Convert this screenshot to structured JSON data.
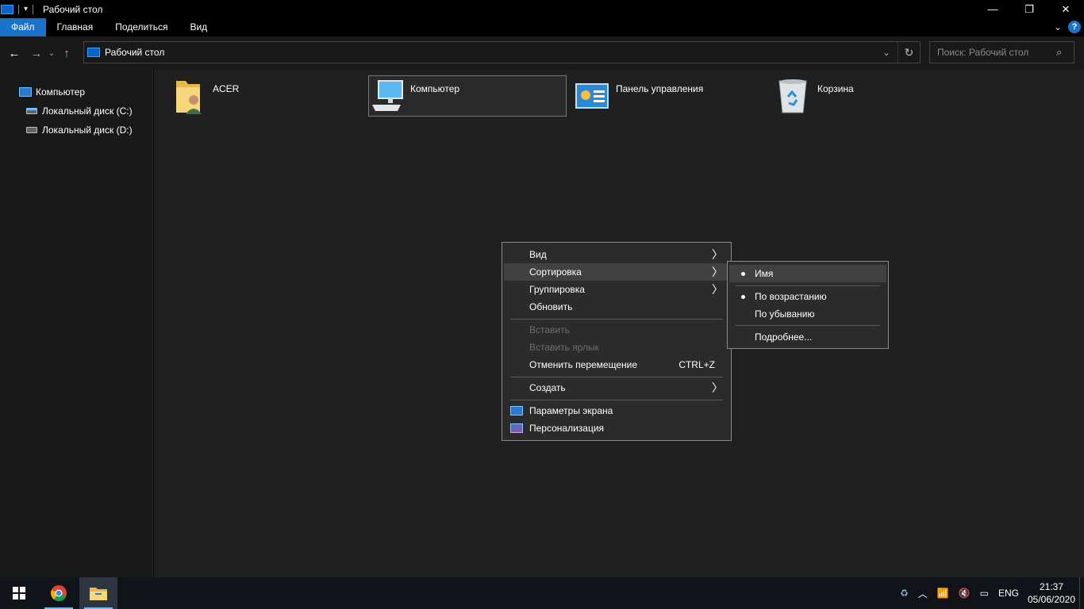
{
  "window": {
    "title": "Рабочий стол",
    "controls": {
      "minimize": "—",
      "maximize": "❐",
      "close": "✕"
    }
  },
  "ribbon": {
    "tabs": [
      "Файл",
      "Главная",
      "Поделиться",
      "Вид"
    ],
    "active_tab": "Файл",
    "help": "?"
  },
  "navbar": {
    "address": "Рабочий стол",
    "search_placeholder": "Поиск: Рабочий стол"
  },
  "sidebar": {
    "items": [
      {
        "label": "Компьютер",
        "icon": "computer-icon"
      },
      {
        "label": "Локальный диск (C:)",
        "icon": "system-drive-icon"
      },
      {
        "label": "Локальный диск (D:)",
        "icon": "drive-icon"
      }
    ]
  },
  "content": {
    "items": [
      {
        "label": "ACER",
        "icon": "user-folder-icon",
        "selected": false
      },
      {
        "label": "Компьютер",
        "icon": "computer-icon",
        "selected": true
      },
      {
        "label": "Панель управления",
        "icon": "control-panel-icon",
        "selected": false
      },
      {
        "label": "Корзина",
        "icon": "recycle-bin-icon",
        "selected": false
      }
    ]
  },
  "context_menu": {
    "items": [
      {
        "label": "Вид",
        "submenu": true
      },
      {
        "label": "Сортировка",
        "submenu": true,
        "highlighted": true
      },
      {
        "label": "Группировка",
        "submenu": true
      },
      {
        "label": "Обновить"
      },
      {
        "label": "Вставить",
        "disabled": true
      },
      {
        "label": "Вставить ярлык",
        "disabled": true
      },
      {
        "label": "Отменить перемещение",
        "shortcut": "CTRL+Z"
      },
      {
        "label": "Создать",
        "submenu": true
      },
      {
        "label": "Параметры экрана",
        "icon": "display-settings-icon"
      },
      {
        "label": "Персонализация",
        "icon": "personalization-icon"
      }
    ]
  },
  "sort_submenu": {
    "items": [
      {
        "label": "Имя",
        "checked": true
      },
      {
        "label": "По возрастанию",
        "checked": true
      },
      {
        "label": "По убыванию",
        "checked": false
      },
      {
        "label": "Подробнее..."
      }
    ]
  },
  "taskbar": {
    "apps": [
      "start-icon",
      "chrome-icon",
      "file-explorer-icon"
    ],
    "tray": {
      "language": "ENG",
      "time": "21:37",
      "date": "05/06/2020"
    }
  },
  "colors": {
    "accent": "#1a73c8",
    "content_bg": "#202020",
    "menu_bg": "#2b2b2b"
  }
}
